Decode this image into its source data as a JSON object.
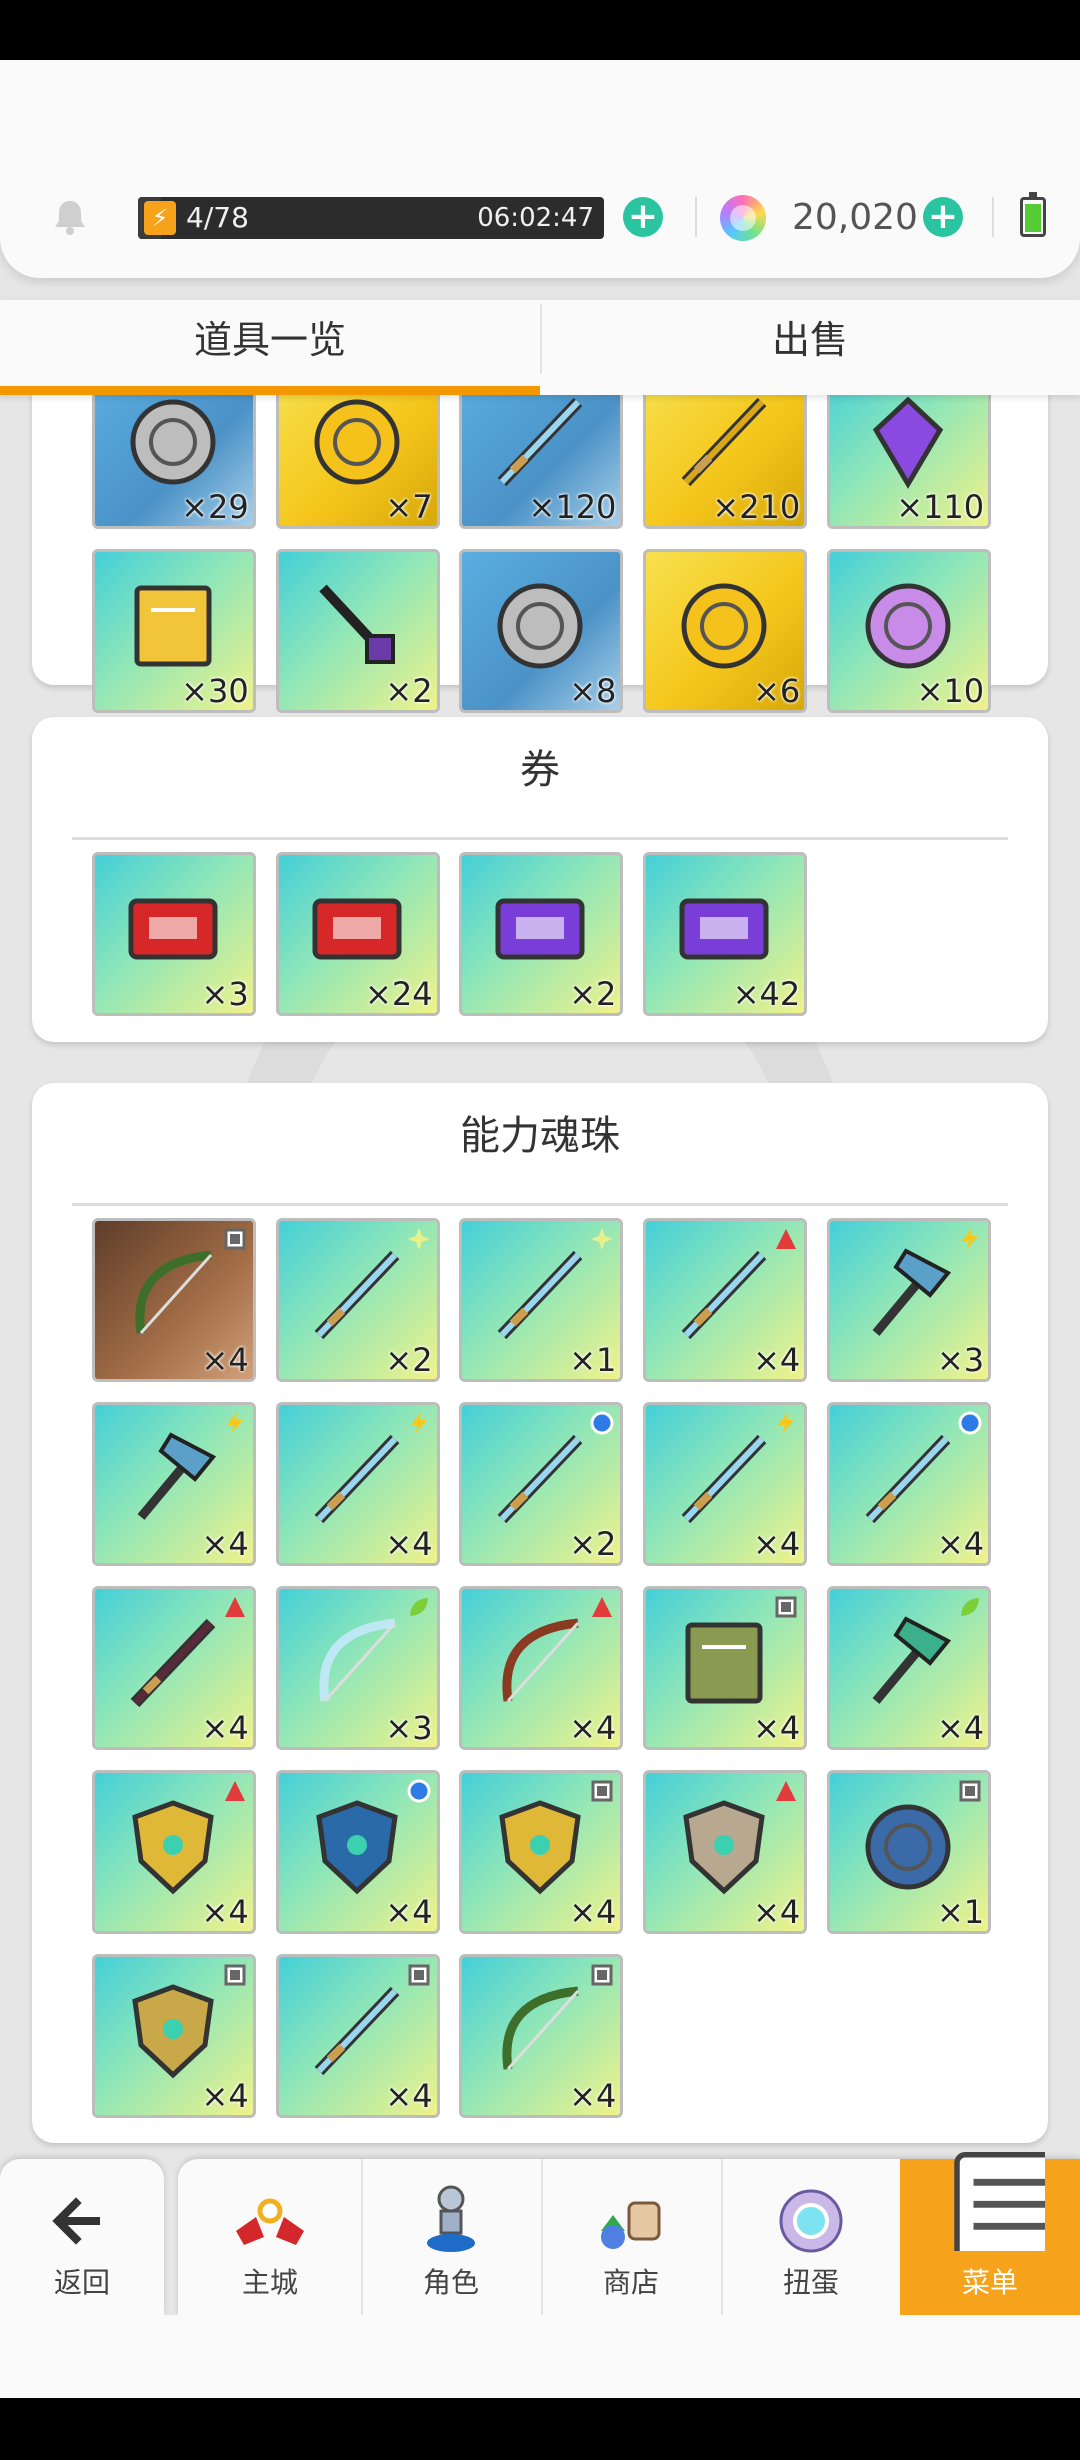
{
  "hud": {
    "energy": "4/78",
    "energy_fraction": 0.05,
    "energy_timer": "06:02:47",
    "gems": "20,020",
    "plus_symbol": "+"
  },
  "tabs": [
    {
      "label": "道具一览",
      "active": true
    },
    {
      "label": "出售",
      "active": false
    }
  ],
  "sections": {
    "items": {
      "row1": [
        {
          "name": "silver-coin-icon",
          "count": "×29",
          "bg": "steel"
        },
        {
          "name": "gold-disc-icon",
          "count": "×7",
          "bg": "gold"
        },
        {
          "name": "silver-sword-icon",
          "count": "×120",
          "bg": "steel"
        },
        {
          "name": "gold-sword-icon",
          "count": "×210",
          "bg": "gold"
        },
        {
          "name": "purple-crystal-icon",
          "count": "×110",
          "bg": "cyan"
        }
      ],
      "row2": [
        {
          "name": "scroll-icon",
          "count": "×30",
          "bg": "cyan"
        },
        {
          "name": "key-icon",
          "count": "×2",
          "bg": "cyan"
        },
        {
          "name": "silver-medal-icon",
          "count": "×8",
          "bg": "steel"
        },
        {
          "name": "gold-medal-icon",
          "count": "×6",
          "bg": "gold"
        },
        {
          "name": "purple-medal-icon",
          "count": "×10",
          "bg": "cyan"
        }
      ]
    },
    "tickets": {
      "title": "券",
      "items": [
        {
          "name": "red-ticket-icon",
          "count": "×3"
        },
        {
          "name": "red-ticket-stack-icon",
          "count": "×24"
        },
        {
          "name": "purple-ticket-icon",
          "count": "×2"
        },
        {
          "name": "purple-ticket-single-icon",
          "count": "×42"
        }
      ]
    },
    "orbs": {
      "title": "能力魂珠",
      "items": [
        {
          "name": "bow-icon",
          "count": "×4",
          "badge": "square",
          "bg": "brown"
        },
        {
          "name": "sword-icon",
          "count": "×2",
          "badge": "sparkle"
        },
        {
          "name": "dagger-icon",
          "count": "×1",
          "badge": "sparkle"
        },
        {
          "name": "staff-icon",
          "count": "×4",
          "badge": "fire"
        },
        {
          "name": "hammer-icon",
          "count": "×3",
          "badge": "bolt"
        },
        {
          "name": "axe-icon",
          "count": "×4",
          "badge": "bolt"
        },
        {
          "name": "scythe-icon",
          "count": "×4",
          "badge": "bolt"
        },
        {
          "name": "spear-icon",
          "count": "×2",
          "badge": "water"
        },
        {
          "name": "lance-icon",
          "count": "×4",
          "badge": "bolt"
        },
        {
          "name": "trident-icon",
          "count": "×4",
          "badge": "water"
        },
        {
          "name": "dark-spear-icon",
          "count": "×4",
          "badge": "fire"
        },
        {
          "name": "ice-bow-icon",
          "count": "×3",
          "badge": "leaf"
        },
        {
          "name": "fire-bow-icon",
          "count": "×4",
          "badge": "fire"
        },
        {
          "name": "book-icon",
          "count": "×4",
          "badge": "square"
        },
        {
          "name": "green-axe-icon",
          "count": "×4",
          "badge": "leaf"
        },
        {
          "name": "gold-shield-icon",
          "count": "×4",
          "badge": "fire"
        },
        {
          "name": "blue-shield-icon",
          "count": "×4",
          "badge": "water"
        },
        {
          "name": "emerald-crest-icon",
          "count": "×4",
          "badge": "square"
        },
        {
          "name": "stone-crest-icon",
          "count": "×4",
          "badge": "fire"
        },
        {
          "name": "round-shield-icon",
          "count": "×1",
          "badge": "square"
        },
        {
          "name": "helmet-icon",
          "count": "×4",
          "badge": "square"
        },
        {
          "name": "wand-icon",
          "count": "×4",
          "badge": "square"
        },
        {
          "name": "crossbow-icon",
          "count": "×4",
          "badge": "square"
        }
      ]
    }
  },
  "bottom_nav": [
    {
      "name": "back",
      "label": "返回",
      "icon": "arrow-left-icon"
    },
    {
      "name": "home",
      "label": "主城",
      "icon": "castle-icon"
    },
    {
      "name": "character",
      "label": "角色",
      "icon": "character-icon"
    },
    {
      "name": "shop",
      "label": "商店",
      "icon": "shop-icon"
    },
    {
      "name": "gacha",
      "label": "扭蛋",
      "icon": "gacha-icon"
    },
    {
      "name": "menu",
      "label": "菜单",
      "icon": "menu-icon",
      "active": true
    }
  ],
  "colors": {
    "accent": "#f39800",
    "menu_active": "#f7a21b",
    "plus": "#2bc4a0",
    "badge_fire": "#e23b3b",
    "badge_bolt": "#f7c81b",
    "badge_water": "#2f7be5",
    "badge_leaf": "#7ccf3b",
    "badge_square": "#666666",
    "badge_sparkle": "#e8f08a"
  }
}
